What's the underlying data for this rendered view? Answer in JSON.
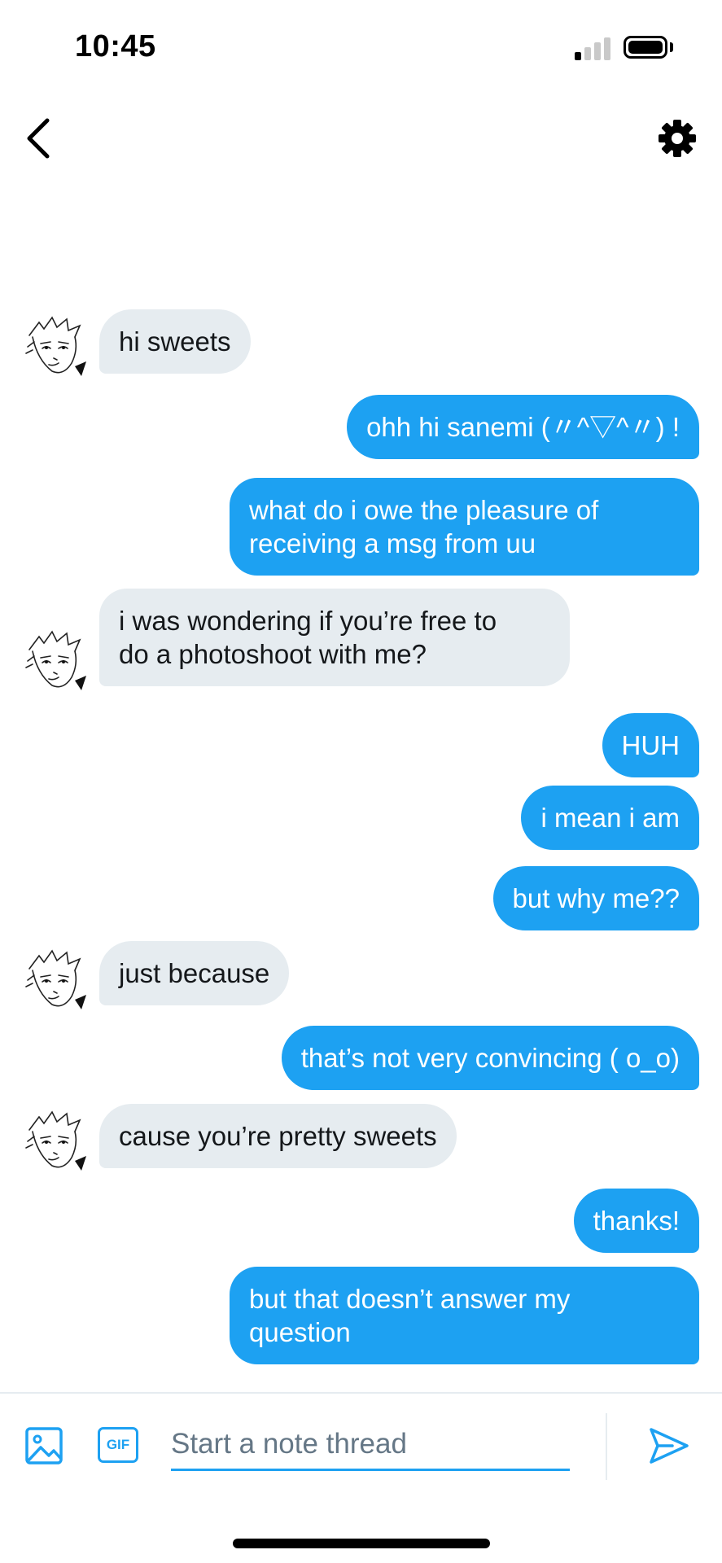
{
  "status_bar": {
    "time": "10:45",
    "signal_bars_active": 1,
    "signal_bars_total": 4,
    "battery_level": 0.85
  },
  "header": {
    "back_icon": "chevron-left-icon",
    "settings_icon": "gear-icon"
  },
  "messages": [
    {
      "side": "in",
      "text": "hi sweets",
      "lines": [
        "hi sweets"
      ]
    },
    {
      "side": "out",
      "text": "ohh hi sanemi (〃^▽^〃) !",
      "lines": [
        "ohh hi sanemi (〃^▽^〃) !"
      ]
    },
    {
      "side": "out",
      "text": "what do i owe the pleasure of receiving a msg from uu",
      "lines": [
        "what do i owe the pleasure of",
        "receiving a msg from uu"
      ]
    },
    {
      "side": "in",
      "text": "i was wondering if you’re free to do a photoshoot with me?",
      "lines": [
        "i was wondering if you’re free to",
        "do a photoshoot with me?"
      ]
    },
    {
      "side": "out",
      "text": "HUH",
      "lines": [
        "HUH"
      ]
    },
    {
      "side": "out",
      "text": "i mean i am",
      "lines": [
        "i mean i am"
      ]
    },
    {
      "side": "out",
      "text": "but why me??",
      "lines": [
        "but why me??"
      ]
    },
    {
      "side": "in",
      "text": "just because",
      "lines": [
        "just because"
      ]
    },
    {
      "side": "out",
      "text": "that’s not very convincing ( o_o)",
      "lines": [
        "that’s not very convincing ( o_o)"
      ]
    },
    {
      "side": "in",
      "text": "cause you’re pretty sweets",
      "lines": [
        "cause you’re pretty sweets"
      ]
    },
    {
      "side": "out",
      "text": "thanks!",
      "lines": [
        "thanks!"
      ]
    },
    {
      "side": "out",
      "text": "but that doesn’t answer my question",
      "lines": [
        "but that doesn’t answer my",
        "question"
      ]
    }
  ],
  "composer": {
    "image_icon": "image-icon",
    "gif_label": "GIF",
    "placeholder": "Start a note thread",
    "value": "",
    "send_icon": "send-icon"
  },
  "colors": {
    "accent": "#1da1f2",
    "incoming_bubble": "#e6ecf0",
    "incoming_text": "#14171a",
    "outgoing_text": "#ffffff"
  }
}
